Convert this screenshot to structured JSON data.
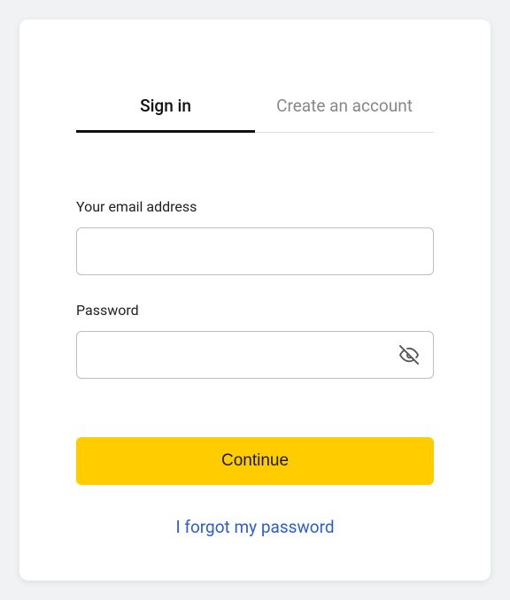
{
  "tabs": {
    "signin": "Sign in",
    "create": "Create an account"
  },
  "form": {
    "email_label": "Your email address",
    "email_value": "",
    "password_label": "Password",
    "password_value": "",
    "submit_label": "Continue",
    "forgot_label": "I forgot my password"
  },
  "colors": {
    "accent": "#ffcc00",
    "link": "#2a5dd7"
  }
}
